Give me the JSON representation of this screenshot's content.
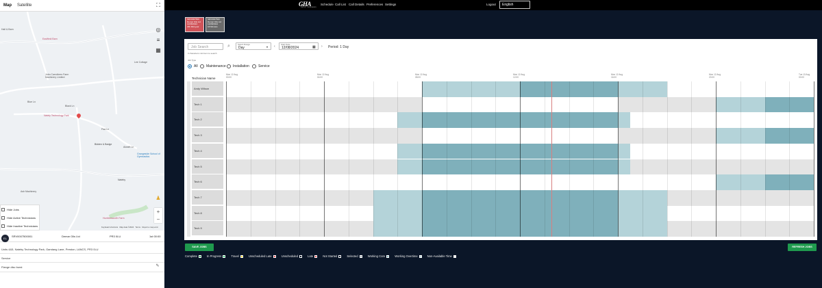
{
  "map": {
    "tabs": [
      "Map",
      "Satellite"
    ],
    "places": {
      "barn": "Eastfield Barn",
      "farm_mach": "John Carrothers Farm Machinery Limited",
      "park": "Nately Technology Park",
      "bidden": "Bidden & Badge",
      "school": "Grangeside School of Gymnastics",
      "ash_mach": "Ash Machinery",
      "humbles": "Humblesworth Farm",
      "nately": "Nateby",
      "hall": "Hall & Barn",
      "lee": "Lee Cottage"
    },
    "roads": [
      "Blue Ln",
      "Black Ln",
      "Paa Ln",
      "Alwath Ln"
    ],
    "checkboxes": [
      "Hide Jobs",
      "Hide Active Technicians",
      "Hide Inactive Technicians"
    ],
    "attribution": [
      "Keyboard shortcuts",
      "Map data ©2024",
      "Terms",
      "Report a map error"
    ]
  },
  "job": {
    "avatar": "EL",
    "code": "SRV0007500001",
    "company": "Demar Oils Ltd",
    "postcode": "PR3 0LU",
    "time": "1st 00:00",
    "address": "Units 4&5, Nateby Technology Park, Garstang Lane, Preston, LANCS, PR3 0LU",
    "type": "Service",
    "description": "Flange disc burst"
  },
  "nav": {
    "logo": "GHA",
    "logo_sub": "GROUP · ENGINEERS",
    "items": [
      "Schedule",
      "Call List",
      "Call Details",
      "Preferences",
      "Settings"
    ],
    "logout": "Logout",
    "language": "English"
  },
  "cards": [
    {
      "lines": [
        "SRV0007500",
        "Demar Oils Ltd",
        "12/08/2024",
        "18h Mid-year"
      ],
      "color": "#d0545a"
    },
    {
      "lines": [
        "SRV0007500",
        "Demar Oils Ltd",
        "12/08/2024",
        "18 Minutes"
      ],
      "color": "#6b6b6b"
    }
  ],
  "schedule": {
    "job_search_placeholder": "Job Search",
    "search_hint": "3 characters minimum to search",
    "range_label": "Select Range",
    "range_value": "Day",
    "start_date_label": "Start Date",
    "start_date": "12/08/2024",
    "period": "Period: 1 Day",
    "job_type_label": "Job Type",
    "job_types": [
      "All",
      "Maintenance",
      "Installation",
      "Service"
    ],
    "selected_job_type": "All",
    "tech_header": "Technician Name",
    "time_headers": [
      {
        "day": "Mon 12 Aug",
        "time": "00:00"
      },
      {
        "day": "Mon 12 Aug",
        "time": "04:00"
      },
      {
        "day": "Mon 12 Aug",
        "time": "08:00"
      },
      {
        "day": "Mon 12 Aug",
        "time": "12:00"
      },
      {
        "day": "Mon 12 Aug",
        "time": "16:00"
      },
      {
        "day": "Mon 12 Aug",
        "time": "20:00"
      },
      {
        "day": "Tue 13 Aug",
        "time": "00:00"
      }
    ],
    "technicians": [
      "Andy Wilson",
      "Tech 1",
      "Tech 2",
      "Tech 3",
      "Tech 4",
      "Tech 5",
      "Tech 6",
      "Tech 7",
      "Tech 8",
      "Tech 9"
    ]
  },
  "footer": {
    "save": "SAVE JOBS",
    "refresh": "REFRESH JOBS",
    "legend": [
      {
        "label": "Complete",
        "color": "#1f9a4e"
      },
      {
        "label": "In Progress",
        "color": "#27c46a"
      },
      {
        "label": "Travel",
        "color": "#f2d21b"
      },
      {
        "label": "Unscheduled Late",
        "color": "#e0474c"
      },
      {
        "label": "Unscheduled",
        "color": "#0b1628"
      },
      {
        "label": "Late",
        "color": "#e0474c"
      },
      {
        "label": "Not Started",
        "color": "#0b1628"
      },
      {
        "label": "Selected",
        "color": "#9aa3ad"
      },
      {
        "label": "Working Core",
        "color": "#7fb0bb"
      },
      {
        "label": "Working Overtime",
        "color": "#b4d3d9"
      },
      {
        "label": "Non-Available Time",
        "color": "#e4e4e4"
      }
    ]
  }
}
